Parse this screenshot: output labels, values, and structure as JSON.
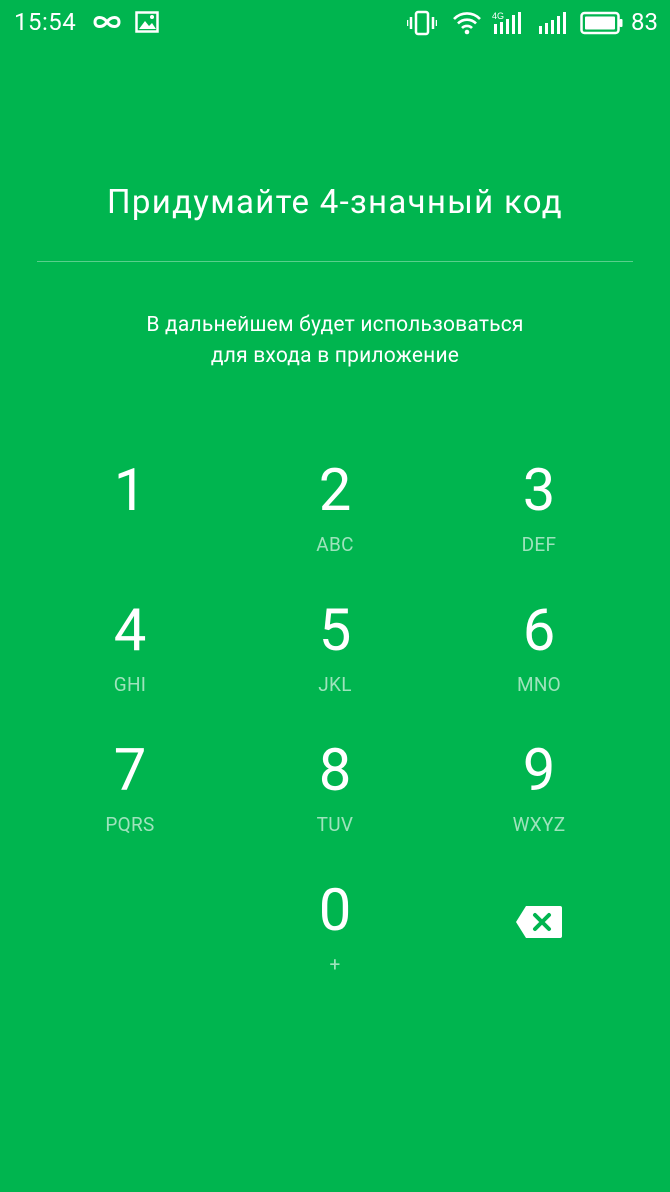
{
  "status_bar": {
    "time": "15:54",
    "battery_percent": "83",
    "network_label": "4G",
    "icons": [
      "infinity-icon",
      "image-icon",
      "vibrate-icon",
      "wifi-icon",
      "cellular-4g-icon",
      "cellular-icon",
      "battery-icon"
    ]
  },
  "header": {
    "title": "Придумайте 4-значный код",
    "subtitle_line1": "В дальнейшем будет использоваться",
    "subtitle_line2": "для входа в приложение"
  },
  "keypad": {
    "keys": [
      {
        "digit": "1",
        "letters": ""
      },
      {
        "digit": "2",
        "letters": "ABC"
      },
      {
        "digit": "3",
        "letters": "DEF"
      },
      {
        "digit": "4",
        "letters": "GHI"
      },
      {
        "digit": "5",
        "letters": "JKL"
      },
      {
        "digit": "6",
        "letters": "MNO"
      },
      {
        "digit": "7",
        "letters": "PQRS"
      },
      {
        "digit": "8",
        "letters": "TUV"
      },
      {
        "digit": "9",
        "letters": "WXYZ"
      },
      {
        "digit": "0",
        "letters": "+"
      }
    ],
    "backspace_icon": "backspace-icon"
  },
  "colors": {
    "background": "#00b54f",
    "text": "#ffffff"
  }
}
